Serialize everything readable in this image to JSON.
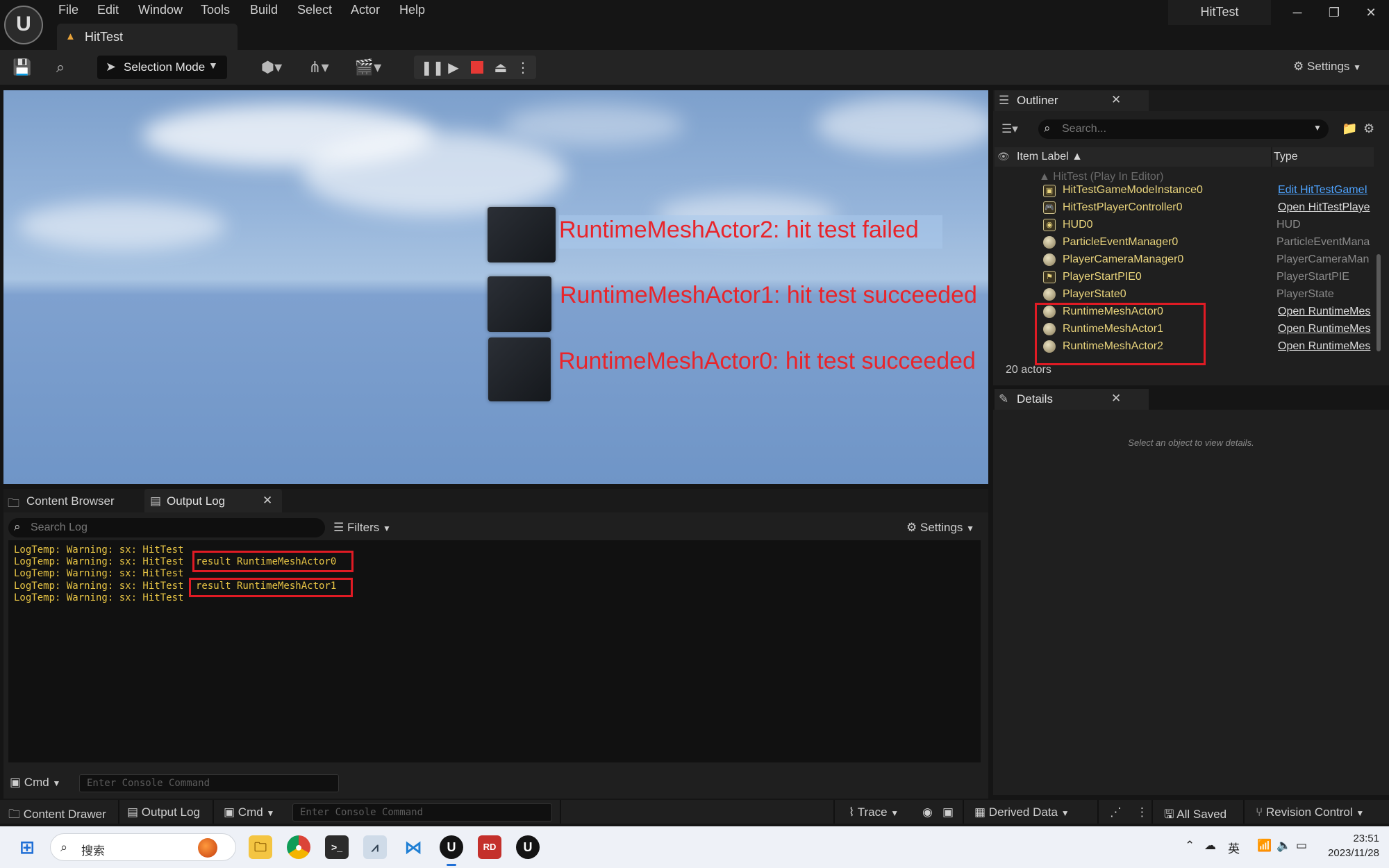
{
  "menu": [
    "File",
    "Edit",
    "Window",
    "Tools",
    "Build",
    "Select",
    "Actor",
    "Help"
  ],
  "window_title": "HitTest",
  "document_tab": "HitTest",
  "toolbar": {
    "selection_mode": "Selection Mode",
    "settings": "Settings"
  },
  "viewport": {
    "labels": [
      "RuntimeMeshActor2: hit test failed",
      "RuntimeMeshActor1: hit test succeeded",
      "RuntimeMeshActor0: hit test succeeded"
    ]
  },
  "outliner": {
    "tab": "Outliner",
    "search_placeholder": "Search...",
    "col_label": "Item Label",
    "col_type": "Type",
    "world_row": "HitTest (Play In Editor)",
    "rows": [
      {
        "name": "HitTestGameModeInstance0",
        "type": "Edit HitTestGameI"
      },
      {
        "name": "HitTestPlayerController0",
        "type": "Open HitTestPlaye"
      },
      {
        "name": "HUD0",
        "type": "HUD"
      },
      {
        "name": "ParticleEventManager0",
        "type": "ParticleEventMana"
      },
      {
        "name": "PlayerCameraManager0",
        "type": "PlayerCameraMan"
      },
      {
        "name": "PlayerStartPIE0",
        "type": "PlayerStartPIE"
      },
      {
        "name": "PlayerState0",
        "type": "PlayerState"
      },
      {
        "name": "RuntimeMeshActor0",
        "type": "Open RuntimeMes"
      },
      {
        "name": "RuntimeMeshActor1",
        "type": "Open RuntimeMes"
      },
      {
        "name": "RuntimeMeshActor2",
        "type": "Open RuntimeMes"
      }
    ],
    "count": "20 actors"
  },
  "details": {
    "tab": "Details",
    "empty_text": "Select an object to view details."
  },
  "bottom_panel": {
    "tabs": [
      "Content Browser",
      "Output Log"
    ],
    "search_placeholder": "Search Log",
    "filters": "Filters",
    "settings": "Settings",
    "log_lines": [
      "LogTemp: Warning: sx: HitTest",
      "LogTemp: Warning: sx: HitTest",
      "LogTemp: Warning: sx: HitTest",
      "LogTemp: Warning: sx: HitTest",
      "LogTemp: Warning: sx: HitTest"
    ],
    "results": [
      "result RuntimeMeshActor0",
      "result RuntimeMeshActor1"
    ],
    "cmd_label": "Cmd",
    "cmd_placeholder": "Enter Console Command"
  },
  "statusbar": {
    "content_drawer": "Content Drawer",
    "output_log": "Output Log",
    "cmd": "Cmd",
    "cmd_placeholder": "Enter Console Command",
    "trace": "Trace",
    "derived_data": "Derived Data",
    "all_saved": "All Saved",
    "revision_control": "Revision Control"
  },
  "taskbar": {
    "search": "搜索",
    "ime": "英",
    "time": "23:51",
    "date": "2023/11/28"
  },
  "colors": {
    "highlight_red": "#e01b24",
    "log_yellow": "#e8c545",
    "viewport_red_text": "#e8252b"
  }
}
